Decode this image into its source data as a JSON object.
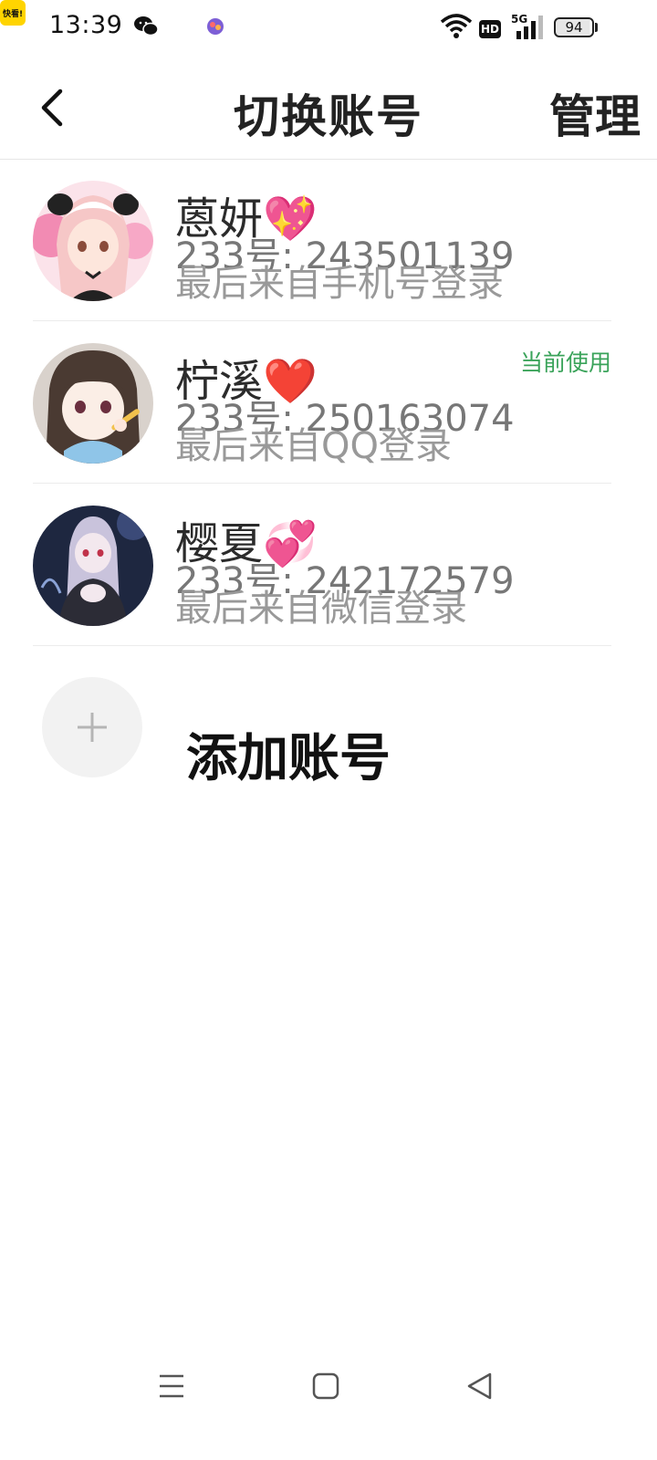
{
  "status_bar": {
    "time": "13:39",
    "battery": "94",
    "network": "5G",
    "hd": "HD",
    "app_badge": "快看!",
    "icons": [
      "wechat-icon",
      "kuaikan-icon",
      "app-icon",
      "wifi-icon",
      "hd-icon",
      "signal-icon",
      "battery-icon"
    ]
  },
  "header": {
    "title": "切换账号",
    "manage_label": "管理",
    "back_icon": "chevron-left-icon"
  },
  "accounts": [
    {
      "name": "蒽妍💖",
      "id_line": "233号: 243501139",
      "login_line": "最后来自手机号登录",
      "current_label": ""
    },
    {
      "name": "柠溪❤️",
      "id_line": "233号: 250163074",
      "login_line": "最后来自QQ登录",
      "current_label": "当前使用"
    },
    {
      "name": "樱夏💞",
      "id_line": "233号: 242172579",
      "login_line": "最后来自微信登录",
      "current_label": ""
    }
  ],
  "add_account": {
    "label": "添加账号",
    "icon": "plus-icon"
  },
  "nav_bar": {
    "icons": [
      "menu-icon",
      "home-square-icon",
      "back-triangle-icon"
    ]
  },
  "colors": {
    "accent_green": "#3aa35a",
    "secondary_text": "#999999",
    "divider": "#ececec"
  }
}
